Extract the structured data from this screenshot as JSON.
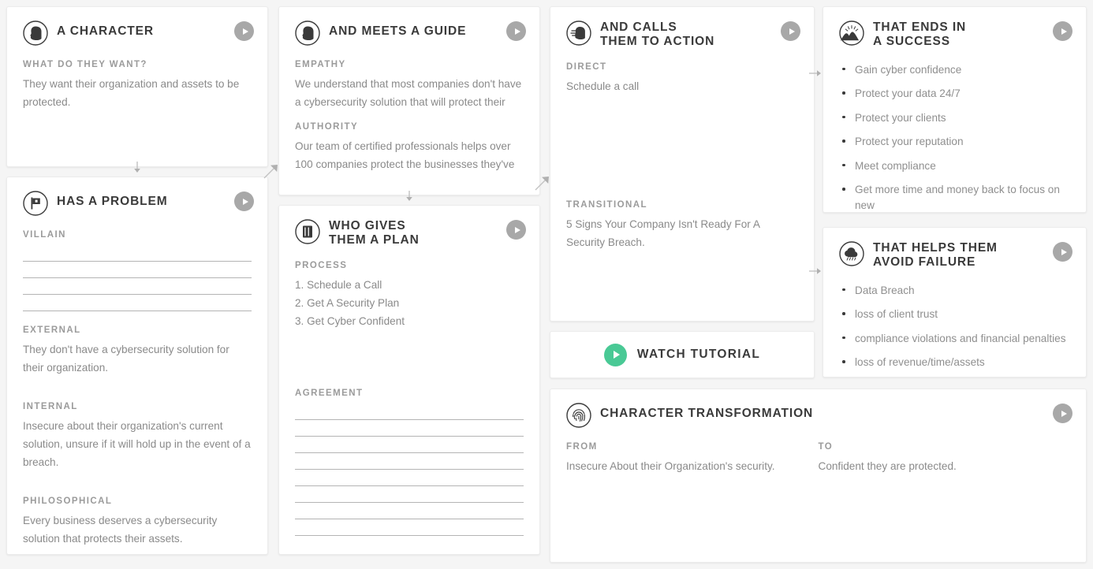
{
  "theme": {
    "page_bg": "#f5f5f5",
    "card_bg": "#ffffff",
    "title_color": "#3a3a3a",
    "label_color": "#9b9b9b",
    "body_color": "#8a8a8a",
    "play_badge_color": "#a8a8a8",
    "accent_green": "#49c995",
    "rule_color": "#b4b4b4"
  },
  "cards": {
    "character": {
      "title": "A CHARACTER",
      "icon": "person-silhouette-icon",
      "play_label": "play",
      "fields": [
        {
          "label": "WHAT DO THEY WANT?",
          "value": "They want their organization and assets to be protected."
        }
      ]
    },
    "problem": {
      "title": "HAS A PROBLEM",
      "icon": "flag-icon",
      "play_label": "play",
      "villain_label": "VILLAIN",
      "villain_lines": 4,
      "fields": [
        {
          "label": "EXTERNAL",
          "value": "They don't have a cybersecurity solution for their organization."
        },
        {
          "label": "INTERNAL",
          "value": "Insecure about their organization's current solution, unsure if it will hold up in the event of a breach."
        },
        {
          "label": "PHILOSOPHICAL",
          "value": "Every business deserves a cybersecurity solution that protects their assets."
        }
      ]
    },
    "guide": {
      "title": "AND MEETS A GUIDE",
      "icon": "person-silhouette-icon",
      "play_label": "play",
      "fields": [
        {
          "label": "EMPATHY",
          "value": "We understand that most companies don't have a cybersecurity solution that will protect their assets"
        },
        {
          "label": "AUTHORITY",
          "value": "Our team of certified professionals helps over 100 companies protect the businesses they've"
        }
      ]
    },
    "plan": {
      "title": "WHO GIVES\nTHEM A PLAN",
      "icon": "book-icon",
      "play_label": "play",
      "process_label": "PROCESS",
      "process_steps": [
        "1. Schedule a Call",
        "2. Get A Security Plan",
        "3. Get Cyber Confident"
      ],
      "agreement_label": "AGREEMENT",
      "agreement_lines": 8
    },
    "action": {
      "title": "AND CALLS\nTHEM TO ACTION",
      "icon": "megaphone-person-icon",
      "play_label": "play",
      "fields": [
        {
          "label": "DIRECT",
          "value": "Schedule a call"
        },
        {
          "label": "TRANSITIONAL",
          "value": "5 Signs Your Company Isn't Ready For A Security Breach."
        }
      ]
    },
    "tutorial": {
      "label": "WATCH TUTORIAL",
      "icon": "play-circle-icon"
    },
    "success": {
      "title": "THAT ENDS IN\nA SUCCESS",
      "icon": "sunrise-mountain-icon",
      "play_label": "play",
      "bullets": [
        "Gain cyber confidence",
        "Protect your data 24/7",
        "Protect your clients",
        "Protect your reputation",
        "Meet compliance",
        "Get more time and money back to focus on new"
      ]
    },
    "failure": {
      "title": "THAT HELPS THEM\nAVOID FAILURE",
      "icon": "storm-cloud-icon",
      "play_label": "play",
      "bullets": [
        "Data Breach",
        "loss of client trust",
        "compliance violations and financial penalties",
        "loss of revenue/time/assets"
      ]
    },
    "transformation": {
      "title": "CHARACTER TRANSFORMATION",
      "icon": "fingerprint-icon",
      "play_label": "play",
      "from_label": "FROM",
      "from_value": "Insecure About their Organization's security.",
      "to_label": "TO",
      "to_value": "Confident they are protected."
    }
  },
  "connectors": [
    {
      "name": "arrow-character-to-problem",
      "direction": "down"
    },
    {
      "name": "arrow-character-to-guide",
      "direction": "up-right"
    },
    {
      "name": "arrow-guide-to-plan",
      "direction": "down"
    },
    {
      "name": "arrow-plan-to-action",
      "direction": "up-right"
    },
    {
      "name": "arrow-action-to-success",
      "direction": "right"
    },
    {
      "name": "arrow-action-to-failure",
      "direction": "right"
    }
  ]
}
